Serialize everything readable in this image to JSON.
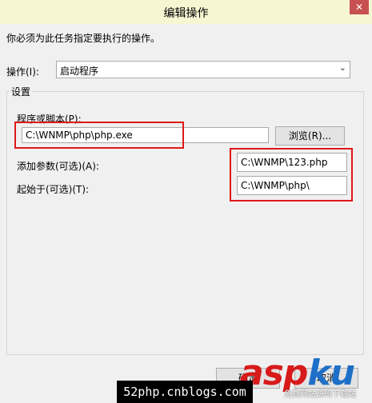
{
  "window": {
    "title": "编辑操作",
    "close_glyph": "✕"
  },
  "instruction": "你必须为此任务指定要执行的操作。",
  "action": {
    "label": "操作(I):",
    "value": "启动程序"
  },
  "settings": {
    "group_label": "设置",
    "program_label": "程序或脚本(P):",
    "program_value": "C:\\WNMP\\php\\php.exe",
    "browse_label": "浏览(R)...",
    "args_label": "添加参数(可选)(A):",
    "args_value": "C:\\WNMP\\123.php",
    "start_label": "起始于(可选)(T):",
    "start_value": "C:\\WNMP\\php\\"
  },
  "buttons": {
    "ok": "确定",
    "cancel": "取消"
  },
  "watermark": {
    "asp": "asp",
    "ku": "ku",
    "sub": "免费网站源码下载站",
    "footer": "52php.cnblogs.com"
  },
  "colors": {
    "highlight": "#e01818",
    "titlebar": "#f7f6d2"
  }
}
